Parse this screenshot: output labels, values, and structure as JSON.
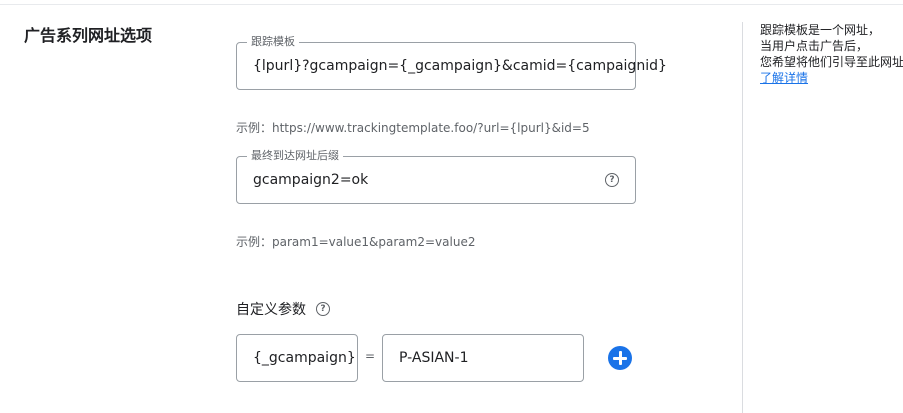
{
  "section": {
    "title": "广告系列网址选项"
  },
  "tracking_template": {
    "label": "跟踪模板",
    "value": "{lpurl}?gcampaign={_gcampaign}&camid={campaignid}",
    "example": "示例：https://www.trackingtemplate.foo/?url={lpurl}&id=5"
  },
  "final_url_suffix": {
    "label": "最终到达网址后缀",
    "value": "gcampaign2=ok",
    "example": "示例：param1=value1&param2=value2"
  },
  "custom_params": {
    "label": "自定义参数",
    "key": "{_gcampaign}",
    "equals": "=",
    "value": "P-ASIAN-1"
  },
  "help_glyph": "?",
  "side_panel": {
    "lines": [
      "跟踪模板是一个网址，",
      "当用户点击广告后，",
      "您希望将他们引导至此网址"
    ],
    "link": "了解详情"
  },
  "colors": {
    "accent": "#1a73e8",
    "border": "#9aa0a6",
    "muted_text": "#5f6368"
  },
  "icons": {
    "help": "help-circle-icon",
    "add": "add-circle-icon"
  }
}
